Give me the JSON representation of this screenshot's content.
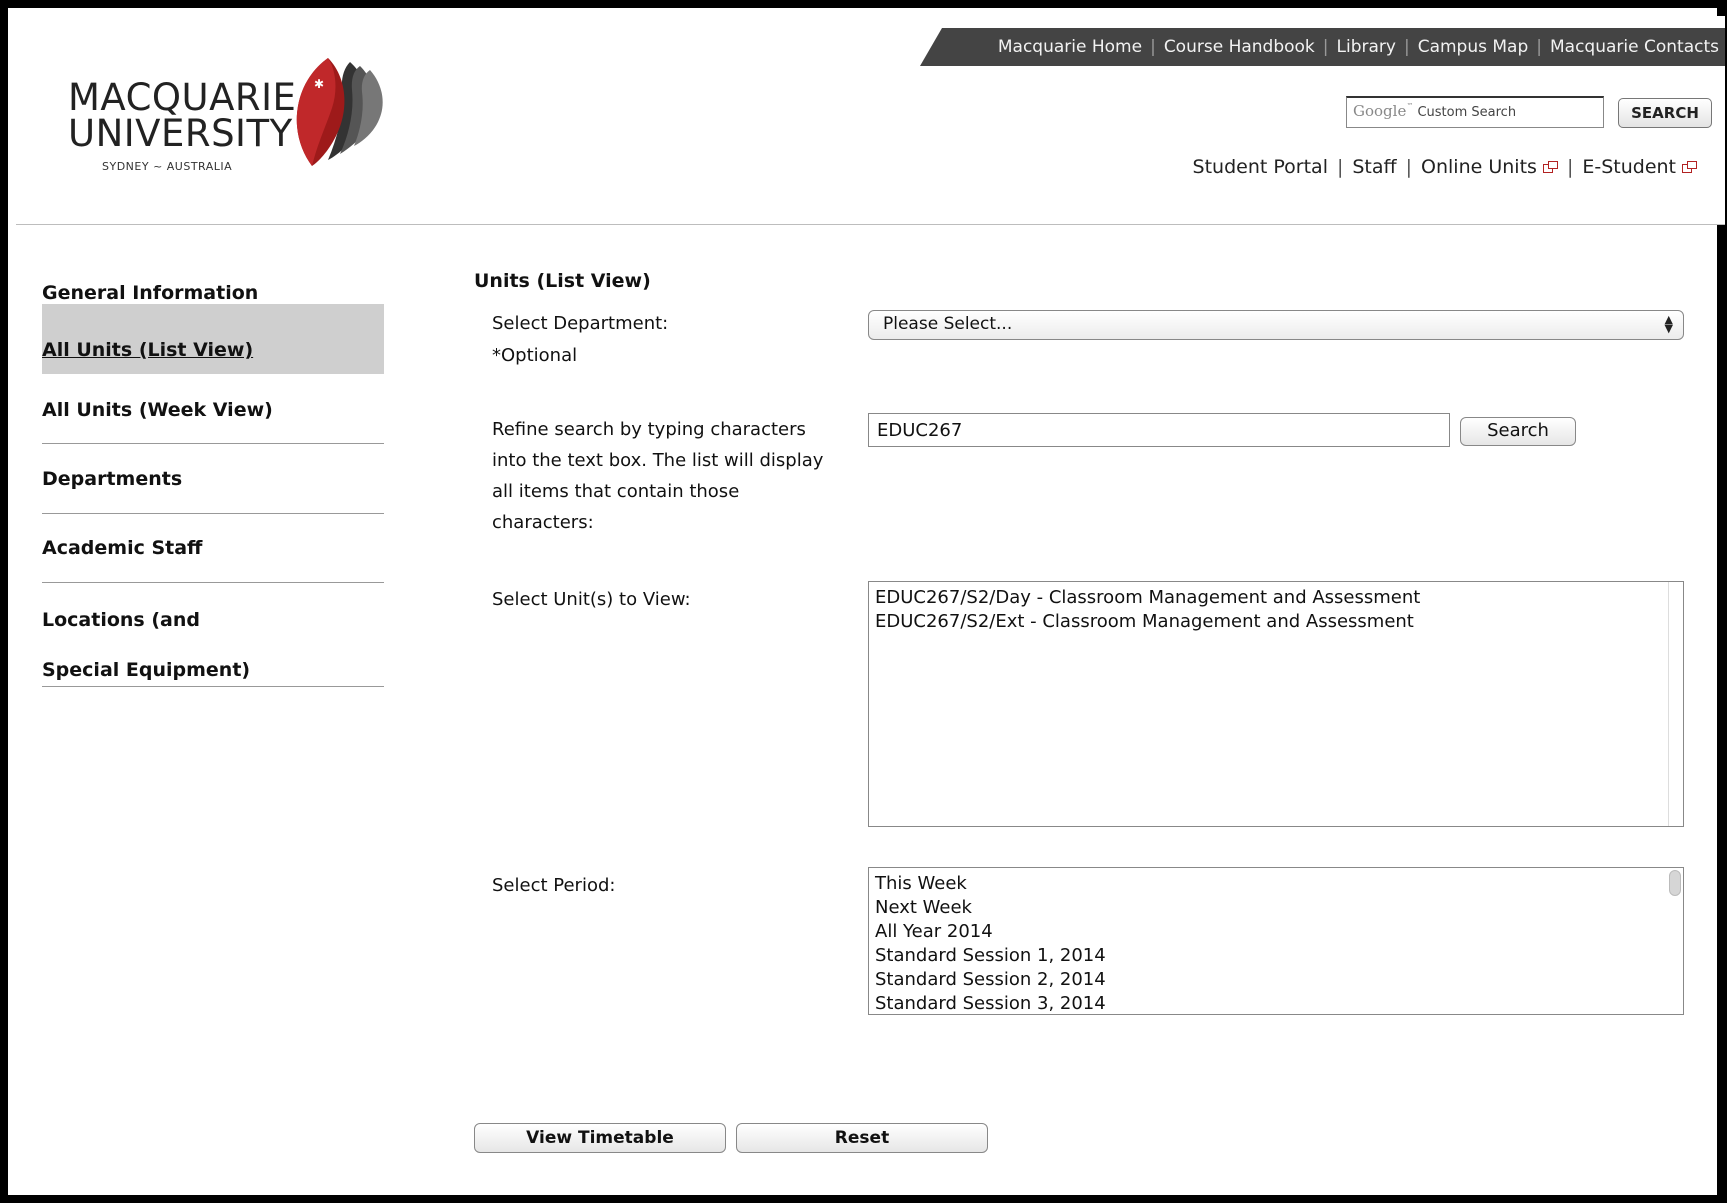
{
  "logo": {
    "line1": "MACQUARIE",
    "line2": "UNIVERSITY",
    "tagline": "SYDNEY ~ AUSTRALIA",
    "brand_color": "#a01c1c"
  },
  "topnav": {
    "items": [
      "Macquarie Home",
      "Course Handbook",
      "Library",
      "Campus Map",
      "Macquarie Contacts"
    ]
  },
  "google_search": {
    "brand": "Google",
    "tm": "™",
    "placeholder": "Custom Search",
    "button_label": "SEARCH"
  },
  "subnav": {
    "items": [
      "Student Portal",
      "Staff",
      "Online Units",
      "E-Student"
    ]
  },
  "sidebar": {
    "items": [
      {
        "label": "General Information"
      },
      {
        "label": "All Units (List View) ",
        "active": true
      },
      {
        "label": "All Units (Week View)"
      },
      {
        "label": "Departments"
      },
      {
        "label": "Academic Staff"
      },
      {
        "label": "Locations (and Special Equipment)"
      }
    ]
  },
  "main": {
    "heading": "Units (List View)",
    "department": {
      "label": "Select Department:",
      "note": "*Optional",
      "selected": "Please Select..."
    },
    "refine": {
      "label": "Refine search by typing characters into the text box. The list will display all items that contain those characters:",
      "value": "EDUC267",
      "button_label": "Search"
    },
    "units": {
      "label": "Select Unit(s) to View:",
      "options": [
        "EDUC267/S2/Day - Classroom Management and Assessment",
        "EDUC267/S2/Ext - Classroom Management and Assessment"
      ]
    },
    "period": {
      "label": "Select Period:",
      "options": [
        "This Week",
        "Next Week",
        "All Year 2014",
        "Standard Session 1, 2014",
        "Standard Session 2, 2014",
        "Standard Session 3, 2014"
      ]
    },
    "actions": {
      "view_label": "View Timetable",
      "reset_label": "Reset"
    }
  }
}
